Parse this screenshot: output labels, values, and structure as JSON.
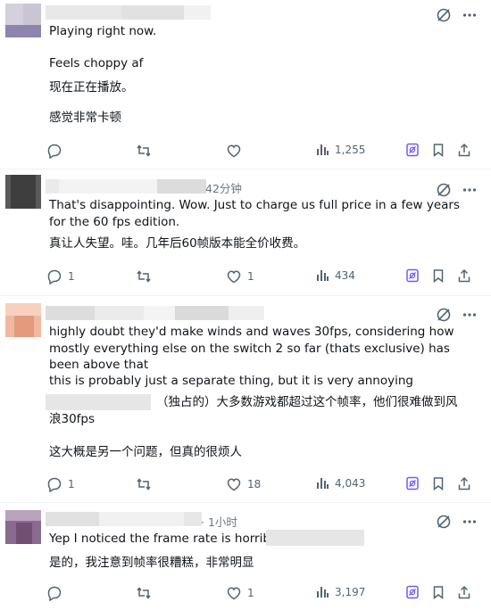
{
  "colors": {
    "text": "#0f1419",
    "muted": "#536471",
    "border": "#eff3f4",
    "grok": "#7856ff"
  },
  "posts": [
    {
      "time": "",
      "lines": [
        "Playing right now.",
        "Feels choppy af",
        "现在正在播放。",
        "感觉非常卡顿"
      ],
      "replies": "",
      "reposts": "",
      "likes": "",
      "views": "1,255"
    },
    {
      "time": "42分钟",
      "lines": [
        "That's disappointing. Wow. Just to charge us full price in a few years for the 60 fps edition.",
        "真让人失望。哇。几年后60帧版本能全价收费。"
      ],
      "replies": "1",
      "reposts": "",
      "likes": "1",
      "views": "434"
    },
    {
      "time": "",
      "lines": [
        "highly doubt they'd make winds and waves 30fps, considering how mostly everything else on the switch 2 so far (thats exclusive) has been above that",
        "this is probably just a separate thing, but it is very annoying",
        "（独占的）大多数游戏都超过这个帧率，他们很难做到风浪30fps",
        "这大概是另一个问题，但真的很烦人"
      ],
      "replies": "1",
      "reposts": "",
      "likes": "18",
      "views": "4,043"
    },
    {
      "time": "· 1小时",
      "lines": [
        "Yep I noticed the frame rate is horrible,",
        "是的，我注意到帧率很糟糕，非常明显"
      ],
      "replies": "",
      "reposts": "",
      "likes": "1",
      "views": "3,197"
    }
  ]
}
